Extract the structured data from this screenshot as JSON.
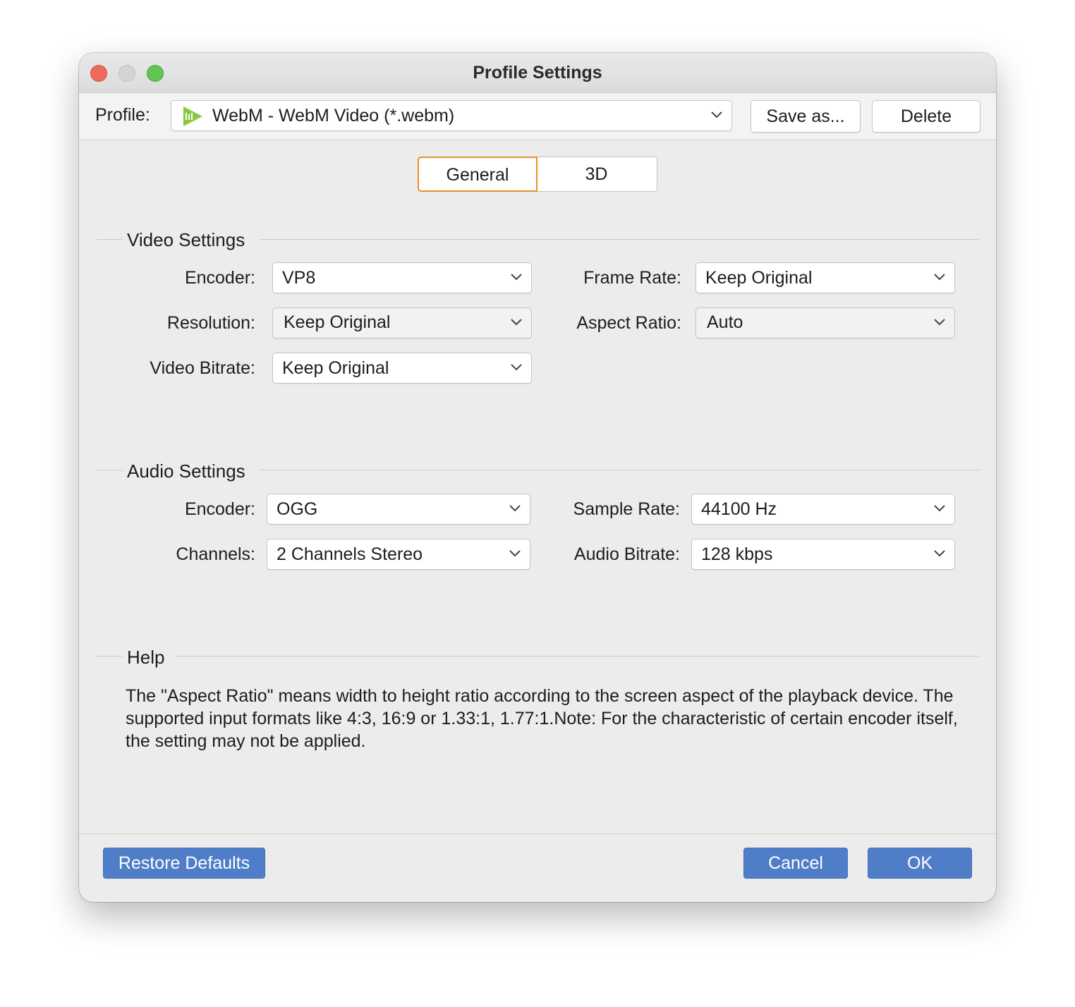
{
  "window": {
    "title": "Profile Settings"
  },
  "profile": {
    "label": "Profile:",
    "selected": "WebM - WebM Video (*.webm)",
    "icon": "webm-play-icon",
    "save_as_label": "Save as...",
    "delete_label": "Delete"
  },
  "tabs": [
    {
      "label": "General",
      "active": true
    },
    {
      "label": "3D",
      "active": false
    }
  ],
  "video": {
    "title": "Video Settings",
    "encoder": {
      "label": "Encoder:",
      "value": "VP8"
    },
    "frame_rate": {
      "label": "Frame Rate:",
      "value": "Keep Original"
    },
    "resolution": {
      "label": "Resolution:",
      "value": "Keep Original"
    },
    "aspect_ratio": {
      "label": "Aspect Ratio:",
      "value": "Auto"
    },
    "bitrate": {
      "label": "Video Bitrate:",
      "value": "Keep Original"
    }
  },
  "audio": {
    "title": "Audio Settings",
    "encoder": {
      "label": "Encoder:",
      "value": "OGG"
    },
    "sample_rate": {
      "label": "Sample Rate:",
      "value": "44100 Hz"
    },
    "channels": {
      "label": "Channels:",
      "value": "2 Channels Stereo"
    },
    "bitrate": {
      "label": "Audio Bitrate:",
      "value": "128 kbps"
    }
  },
  "help": {
    "title": "Help",
    "text": "The \"Aspect Ratio\" means width to height ratio according to the screen aspect of the playback device. The supported input formats like 4:3, 16:9 or 1.33:1, 1.77:1.Note: For the characteristic of certain encoder itself, the setting may not be applied."
  },
  "footer": {
    "restore_label": "Restore Defaults",
    "cancel_label": "Cancel",
    "ok_label": "OK"
  },
  "colors": {
    "accent_blue": "#4f7dc7",
    "tab_active_border": "#e8902a",
    "webm_icon_green": "#8dc63f"
  }
}
